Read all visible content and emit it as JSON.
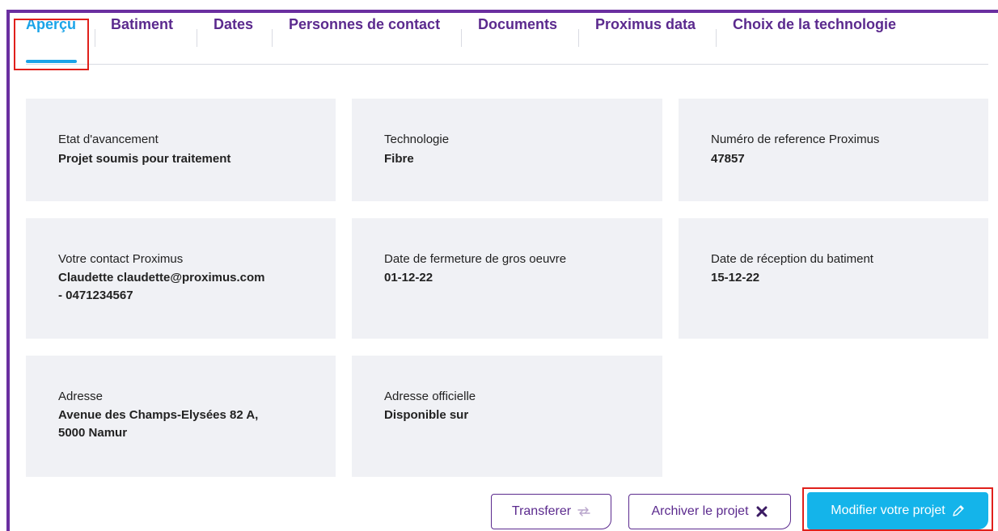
{
  "tabs": [
    {
      "label": "Aperçu",
      "active": true
    },
    {
      "label": "Batiment"
    },
    {
      "label": "Dates"
    },
    {
      "label": "Personnes de contact"
    },
    {
      "label": "Documents"
    },
    {
      "label": "Proximus data"
    },
    {
      "label": "Choix de la technologie"
    }
  ],
  "cards": {
    "status": {
      "label": "Etat d'avancement",
      "value": "Projet soumis pour traitement"
    },
    "technology": {
      "label": "Technologie",
      "value": "Fibre"
    },
    "reference": {
      "label": "Numéro de reference Proximus",
      "value": "47857"
    },
    "contact": {
      "label": "Votre contact Proximus",
      "value_line1": "Claudette claudette@proximus.com",
      "value_line2": "- 0471234567"
    },
    "closing_date": {
      "label": "Date de fermeture de gros oeuvre",
      "value": "01-12-22"
    },
    "reception_date": {
      "label": "Date de réception du batiment",
      "value": "15-12-22"
    },
    "address": {
      "label": "Adresse",
      "value_line1": "Avenue des Champs-Elysées 82 A,",
      "value_line2": "5000 Namur"
    },
    "official_address": {
      "label": "Adresse officielle",
      "value": "Disponible sur"
    }
  },
  "actions": {
    "transfer_label": "Transferer",
    "archive_label": "Archiver le projet",
    "edit_label": "Modifier votre projet"
  },
  "colors": {
    "brand_purple": "#5b2a8e",
    "accent_blue": "#1aa3e8",
    "card_bg": "#f0f1f5",
    "highlight_red": "#e0201b"
  },
  "icons": [
    "transfer-arrows-icon",
    "close-x-icon",
    "pencil-icon"
  ]
}
